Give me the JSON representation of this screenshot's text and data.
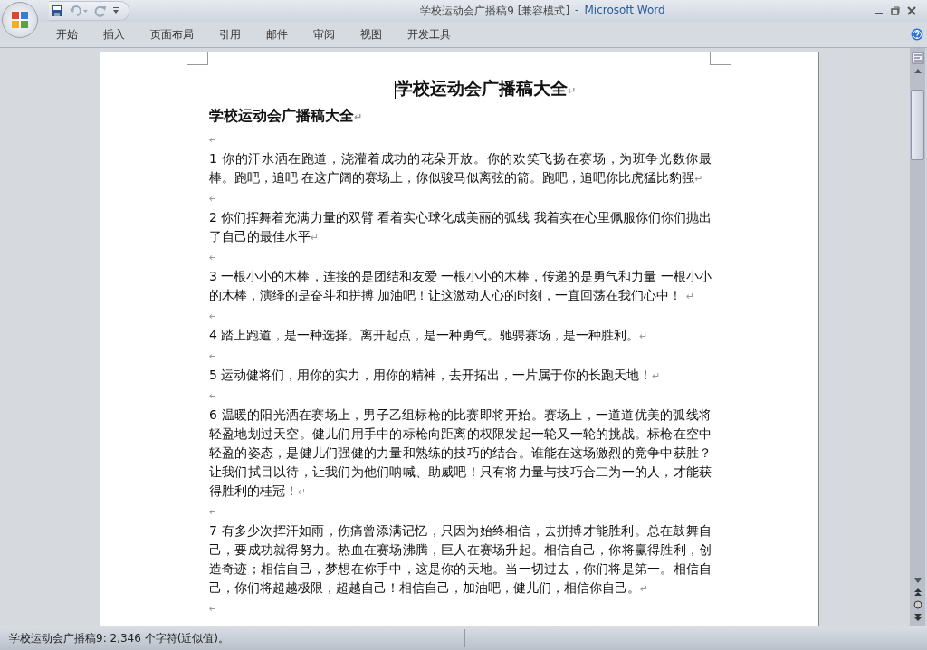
{
  "window": {
    "title": "学校运动会广播稿9 [兼容模式]",
    "separator": "-",
    "app": "Microsoft Word"
  },
  "ribbon": {
    "tabs": [
      {
        "label": "开始",
        "selected": false
      },
      {
        "label": "插入",
        "selected": false
      },
      {
        "label": "页面布局",
        "selected": false
      },
      {
        "label": "引用",
        "selected": false
      },
      {
        "label": "邮件",
        "selected": false
      },
      {
        "label": "审阅",
        "selected": false
      },
      {
        "label": "视图",
        "selected": false
      },
      {
        "label": "开发工具",
        "selected": false
      }
    ]
  },
  "document": {
    "paragraph_mark": "↵",
    "paragraphs": [
      {
        "kind": "title",
        "text": "学校运动会广播稿大全"
      },
      {
        "kind": "heading",
        "text": "学校运动会广播稿大全"
      },
      {
        "kind": "empty"
      },
      {
        "kind": "body",
        "text": "1 你的汗水洒在跑道，浇灌着成功的花朵开放。你的欢笑飞扬在赛场，为班争光数你最棒。跑吧，追吧 在这广阔的赛场上，你似骏马似离弦的箭。跑吧，追吧你比虎猛比豹强"
      },
      {
        "kind": "empty"
      },
      {
        "kind": "body",
        "text": "2 你们挥舞着充满力量的双臂 看着实心球化成美丽的弧线 我着实在心里佩服你们你们抛出了自己的最佳水平"
      },
      {
        "kind": "empty"
      },
      {
        "kind": "body",
        "text": "3 一根小小的木棒，连接的是团结和友爱 一根小小的木棒，传递的是勇气和力量 一根小小的木棒，演绎的是奋斗和拼搏 加油吧！让这激动人心的时刻，一直回荡在我们心中！ "
      },
      {
        "kind": "empty"
      },
      {
        "kind": "body",
        "text": "4 踏上跑道，是一种选择。离开起点，是一种勇气。驰骋赛场，是一种胜利。"
      },
      {
        "kind": "empty"
      },
      {
        "kind": "body",
        "text": "5 运动健将们，用你的实力，用你的精神，去开拓出，一片属于你的长跑天地！"
      },
      {
        "kind": "empty"
      },
      {
        "kind": "body",
        "text": "6 温暖的阳光洒在赛场上，男子乙组标枪的比赛即将开始。赛场上，一道道优美的弧线将轻盈地划过天空。健儿们用手中的标枪向距离的权限发起一轮又一轮的挑战。标枪在空中轻盈的姿态，是健儿们强健的力量和熟练的技巧的结合。谁能在这场激烈的竞争中获胜？让我们拭目以待，让我们为他们呐喊、助威吧！只有将力量与技巧合二为一的人，才能获得胜利的桂冠！"
      },
      {
        "kind": "empty"
      },
      {
        "kind": "body",
        "text": "7 有多少次挥汗如雨，伤痛曾添满记忆，只因为始终相信，去拼搏才能胜利。总在鼓舞自己，要成功就得努力。热血在赛场沸腾，巨人在赛场升起。相信自己，你将赢得胜利，创造奇迹；相信自己，梦想在你手中，这是你的天地。当一切过去，你们将是第一。相信自己，你们将超越极限，超越自己！相信自己，加油吧，健儿们，相信你自己。"
      },
      {
        "kind": "empty"
      }
    ]
  },
  "status_bar": {
    "text": "学校运动会广播稿9: 2,346 个字符(近似值)。"
  }
}
